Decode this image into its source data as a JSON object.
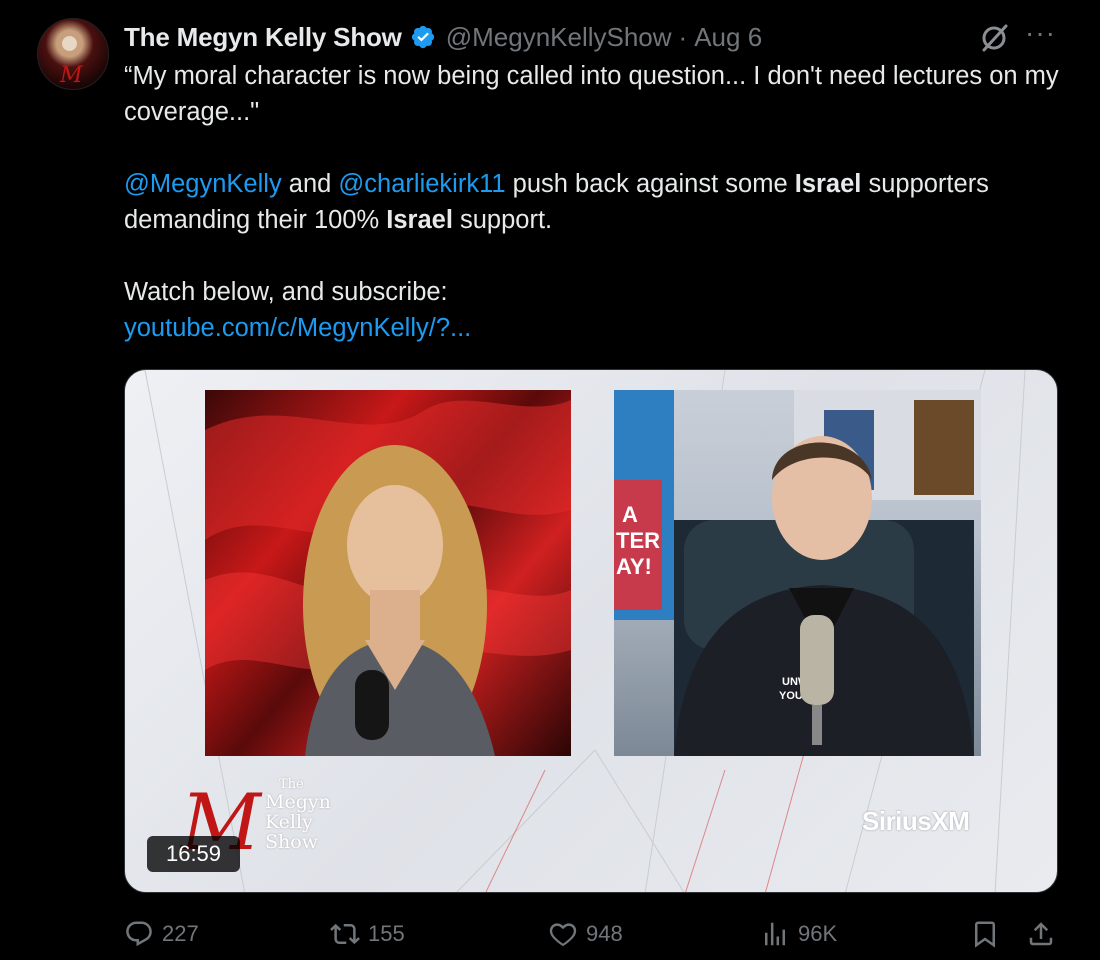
{
  "author": {
    "name": "The Megyn Kelly Show",
    "handle": "@MegynKellyShow",
    "separator": "·",
    "date": "Aug 6"
  },
  "tweet": {
    "line1": "“My moral character is now being called into question... I don't need lectures on my coverage...\"",
    "mention1": "@MegynKelly",
    "and": " and ",
    "mention2": "@charliekirk11",
    "mid1": " push back against some ",
    "israel1": "Israel",
    "mid2": " supporters demanding their 100% ",
    "israel2": "Israel",
    "end": " support.",
    "watch": "Watch below, and subscribe:",
    "link": "youtube.com/c/MegynKelly/?..."
  },
  "media": {
    "duration": "16:59",
    "brand_the": "The",
    "brand_megyn": "Megyn",
    "brand_kelly": "Kelly",
    "brand_show": "Show",
    "brand_m": "M",
    "partner": "SiriusXM",
    "sign_text": "A TER AY!",
    "shirt_text": "UNW YOUR"
  },
  "actions": {
    "replies": "227",
    "reposts": "155",
    "likes": "948",
    "views": "96K"
  },
  "colors": {
    "background": "#000000",
    "text": "#e7e9ea",
    "muted": "#71767b",
    "link": "#1d9bf0",
    "verified": "#1d9bf0",
    "brand_red": "#c01616"
  },
  "icons": [
    "verified-badge-icon",
    "grok-icon",
    "more-icon",
    "reply-icon",
    "repost-icon",
    "like-icon",
    "views-icon",
    "bookmark-icon",
    "share-icon"
  ]
}
